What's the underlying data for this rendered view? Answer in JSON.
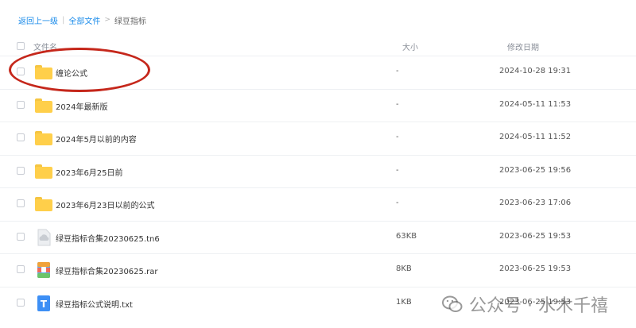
{
  "breadcrumb": {
    "back": "返回上一级",
    "sep1": "|",
    "all_files": "全部文件",
    "sep2": ">",
    "current": "绿豆指标"
  },
  "header": {
    "name": "文件名",
    "size": "大小",
    "modified": "修改日期"
  },
  "files": [
    {
      "type": "folder",
      "name": "缠论公式",
      "size": "-",
      "modified": "2024-10-28 19:31"
    },
    {
      "type": "folder",
      "name": "2024年最新版",
      "size": "-",
      "modified": "2024-05-11 11:53"
    },
    {
      "type": "folder",
      "name": "2024年5月以前的内容",
      "size": "-",
      "modified": "2024-05-11 11:52"
    },
    {
      "type": "folder",
      "name": "2023年6月25日前",
      "size": "-",
      "modified": "2023-06-25 19:56"
    },
    {
      "type": "folder",
      "name": "2023年6月23日以前的公式",
      "size": "-",
      "modified": "2023-06-23 17:06"
    },
    {
      "type": "tn6",
      "name": "绿豆指标合集20230625.tn6",
      "size": "63KB",
      "modified": "2023-06-25 19:53"
    },
    {
      "type": "rar",
      "name": "绿豆指标合集20230625.rar",
      "size": "8KB",
      "modified": "2023-06-25 19:53"
    },
    {
      "type": "txt",
      "name": "绿豆指标公式说明.txt",
      "size": "1KB",
      "modified": "2023-06-25 19:53"
    }
  ],
  "watermark": "公众号 · 水木千禧",
  "colors": {
    "link": "#1a8bea",
    "folder": "#ffcf4a",
    "annotation": "#c5271b"
  }
}
